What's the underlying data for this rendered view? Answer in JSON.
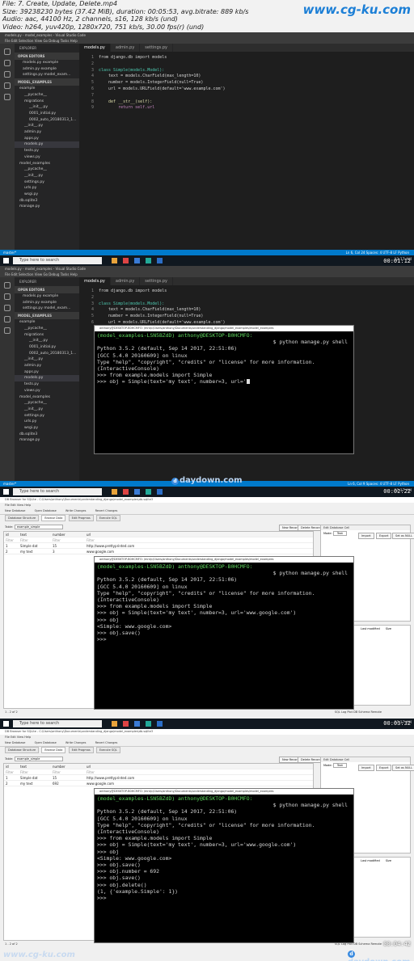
{
  "info": {
    "line1": "File: 7. Create, Update, Delete.mp4",
    "line2": "Size: 39238230 bytes (37.42 MiB), duration: 00:05:53, avg.bitrate: 889 kb/s",
    "line3": "Audio: aac, 44100 Hz, 2 channels, s16, 128 kb/s (und)",
    "line4": "Video: h264, yuv420p, 1280x720, 751 kb/s, 30.00 fps(r) (und)",
    "brand": "www.cg-ku.com"
  },
  "vscode": {
    "title": "models.py - model_examples - Visual Studio Code",
    "menu": "File  Edit  Selection  View  Go  Debug  Tasks  Help",
    "explorer_label": "EXPLORER",
    "open_editors": "OPEN EDITORS",
    "project": "MODEL_EXAMPLES",
    "files": [
      "models.py  example",
      "admin.py  example",
      "settings.py  model_exam..."
    ],
    "tree": [
      "example",
      "__pycache__",
      "migrations",
      "__init__.py",
      "0001_initial.py",
      "0002_auto_20180313_1...",
      "__init__.py",
      "admin.py",
      "apps.py",
      "models.py",
      "tests.py",
      "views.py",
      "model_examples",
      "__pycache__",
      "__init__.py",
      "settings.py",
      "urls.py",
      "wsgi.py",
      "db.sqlite3",
      "manage.py"
    ],
    "tabs": [
      "models.py",
      "admin.py",
      "settings.py"
    ],
    "status_branch": "master*",
    "status_right_1": "Ln 6, Col 24   Spaces: 4   UTF-8   LF   Python",
    "status_right_2": "Ln 6, Col 9   Spaces: 4   UTF-8   LF   Python",
    "status_right_3": "Ln 6, Col 9   Spaces: 4   UTF-8   LF   Python"
  },
  "code1": [
    "from django.db import models",
    "",
    "class Simple(models.Model):",
    "    text = models.CharField(max_length=10)",
    "    number = models.IntegerField(null=True)",
    "    url = models.URLField(default='www.example.com')",
    "",
    "    def __str__(self):",
    "        return self.url"
  ],
  "code2": [
    "from django.db import models",
    "",
    "class Simple(models.Model):",
    "    text = models.CharField(max_length=10)",
    "    number = models.IntegerField(null=True)",
    "    url = models.URLField(default='www.example.com')"
  ],
  "taskbar": {
    "search": "Type here to search",
    "clock": "12:17 AM"
  },
  "timestamps": [
    "00:01:12",
    "00:02:22",
    "00:03:32",
    "00:04:42"
  ],
  "watermark": "daydown.com",
  "watermark_bottom_left": "www.cg-ku.com",
  "terminal": {
    "title": "anthony@DESKTOP-B0HCMFO: /mnt/c/Users/anthony/Documents/understanding_django/model_examples/model_examples",
    "prompt_env": "(model_examples-LSN5BZdD) ",
    "prompt_user": "anthony@DESKTOP-B0HCMFO:",
    "prompt_path": "/mnt/c/Users/anthony/Documents/understanding_django/model_examples/model_examples",
    "cmd": "$ python manage.py shell",
    "l1": "Python 3.5.2 (default, Sep 14 2017, 22:51:06)",
    "l2": "[GCC 5.4.0 20160609] on linux",
    "l3": "Type \"help\", \"copyright\", \"credits\" or \"license\" for more information.",
    "l4": "(InteractiveConsole)",
    "l5": ">>> from example.models import Simple",
    "f1_l6": ">>> obj = Simple(text='my text', number=3, url='",
    "f2_l6": ">>> obj = Simple(text='my text', number=3, url='www.google.com')",
    "f2_l7": ">>> obj",
    "f2_l8": "<Simple: www.google.com>",
    "f2_l9": ">>> obj.save()",
    "f2_l10": ">>>",
    "f3_l9": ">>> obj.save()",
    "f3_l10": ">>> obj.number = 692",
    "f3_l11": ">>> obj.save()",
    "f3_l12": ">>> obj.delete()",
    "f3_l13": "(1, {'example.Simple': 1})",
    "f3_l14": ">>>"
  },
  "db": {
    "title": "DB Browser for SQLite - C:\\Users\\anthony\\Documents\\understanding_django\\model_examples\\db.sqlite3",
    "menu": "File  Edit  View  Help",
    "toolbar": [
      "New Database",
      "Open Database",
      "Write Changes",
      "Revert Changes"
    ],
    "tabs": [
      "Database Structure",
      "Browse Data",
      "Edit Pragmas",
      "Execute SQL"
    ],
    "table_label": "Table:",
    "table_name": "example_simple",
    "new_record": "New Record",
    "delete_record": "Delete Record",
    "columns": [
      "id",
      "text",
      "number",
      "url"
    ],
    "filter": "Filter",
    "rows_f3": [
      [
        "1",
        "Simple dat",
        "15",
        "http://www.prettyprinted.com"
      ],
      [
        "2",
        "my text",
        "3",
        "www.google.com"
      ]
    ],
    "rows_f4": [
      [
        "1",
        "Simple dat",
        "15",
        "http://www.prettyprinted.com"
      ],
      [
        "2",
        "my text",
        "692",
        "www.google.com"
      ]
    ],
    "pager": "1 - 2 of 2",
    "edit_cell": "Edit Database Cell",
    "mode_label": "Mode:",
    "mode": "Text",
    "import": "Import",
    "export": "Export",
    "set_null": "Set as NULL",
    "last_modified": "Last modified",
    "size": "Size",
    "bottom_tabs": [
      "SQL Log",
      "Plot",
      "DB Schema",
      "Remote"
    ]
  }
}
